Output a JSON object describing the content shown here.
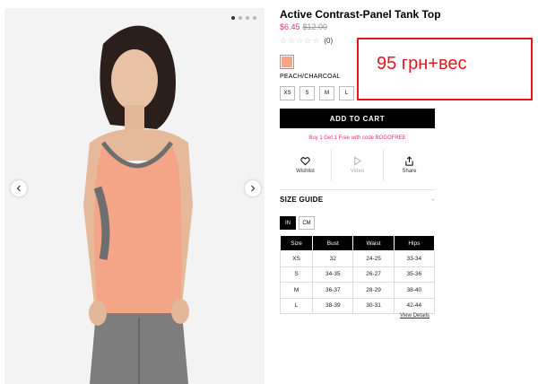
{
  "product": {
    "title": "Active Contrast-Panel Tank Top",
    "price_sale": "$6.45",
    "price_original": "$12.00",
    "rating_count": "(0)",
    "stars": [
      "☆",
      "☆",
      "☆",
      "☆",
      "☆"
    ],
    "color_name": "PEACH/CHARCOAL",
    "color_hex": "#f4a487",
    "sizes": [
      "XS",
      "S",
      "M",
      "L"
    ],
    "add_to_cart": "ADD TO CART",
    "promo": "Buy 1 Get 1 Free with code BOGOFREE"
  },
  "actions": {
    "wishlist": "Wishlist",
    "video": "Video",
    "share": "Share"
  },
  "size_guide": {
    "heading": "SIZE GUIDE",
    "toggle": "-",
    "units": [
      "IN",
      "CM"
    ],
    "active_unit": "IN",
    "columns": [
      "Size",
      "Bust",
      "Waist",
      "Hips"
    ],
    "rows": [
      [
        "XS",
        "32",
        "24-25",
        "33-34"
      ],
      [
        "S",
        "34-35",
        "26-27",
        "35-36"
      ],
      [
        "M",
        "36-37",
        "28-29",
        "38-40"
      ],
      [
        "L",
        "38-39",
        "30-31",
        "42-44"
      ]
    ],
    "view_details": "View Details"
  },
  "gallery": {
    "slide_count": 4,
    "active_slide": 0
  },
  "annotation": {
    "text": "95 грн+вес",
    "color": "#e8141e"
  }
}
